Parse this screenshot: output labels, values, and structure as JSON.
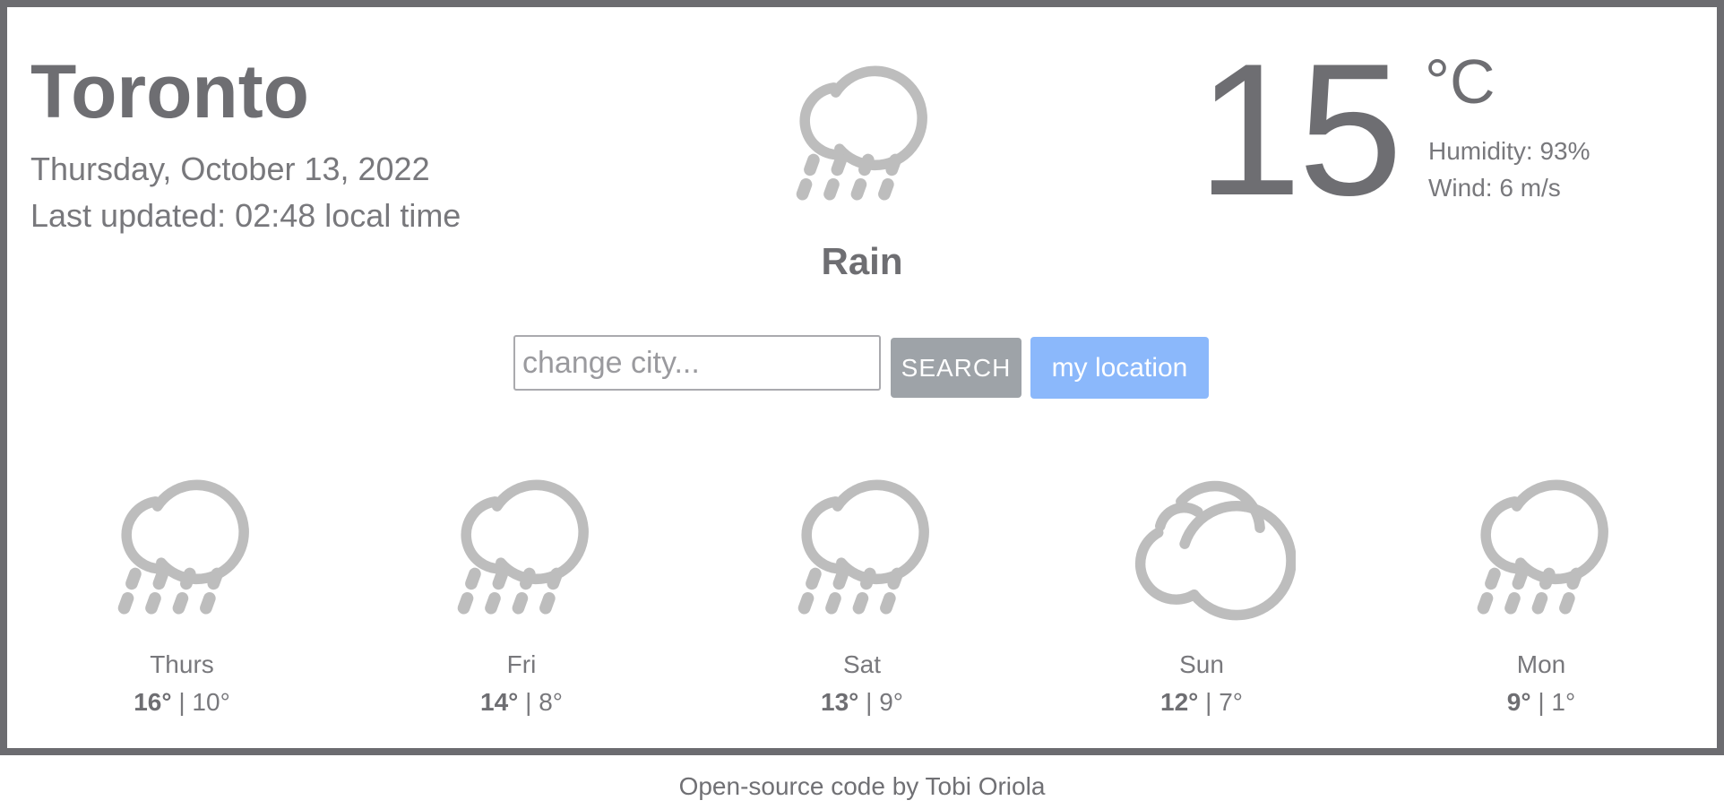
{
  "current": {
    "city": "Toronto",
    "date": "Thursday, October 13, 2022",
    "updated": "Last updated: 02:48 local time",
    "description": "Rain",
    "icon": "rain-icon",
    "temperature": "15",
    "unit": "°C",
    "humidity": "Humidity: 93%",
    "wind": "Wind: 6 m/s"
  },
  "search": {
    "placeholder": "change city...",
    "search_label": "SEARCH",
    "location_label": "my location"
  },
  "forecast": [
    {
      "day": "Thurs",
      "high": "16°",
      "low": "10°",
      "icon": "rain-icon"
    },
    {
      "day": "Fri",
      "high": "14°",
      "low": "8°",
      "icon": "rain-icon"
    },
    {
      "day": "Sat",
      "high": "13°",
      "low": "9°",
      "icon": "rain-icon"
    },
    {
      "day": "Sun",
      "high": "12°",
      "low": "7°",
      "icon": "cloudy-icon"
    },
    {
      "day": "Mon",
      "high": "9°",
      "low": "1°",
      "icon": "rain-icon"
    }
  ],
  "separator": "|",
  "footer": "Open-source code by Tobi Oriola",
  "colors": {
    "frame": "#6c6c70",
    "text": "#6e6e72",
    "icon": "#bdbdbd",
    "search_button": "#9ea3a8",
    "location_button": "#8bb8fb"
  }
}
